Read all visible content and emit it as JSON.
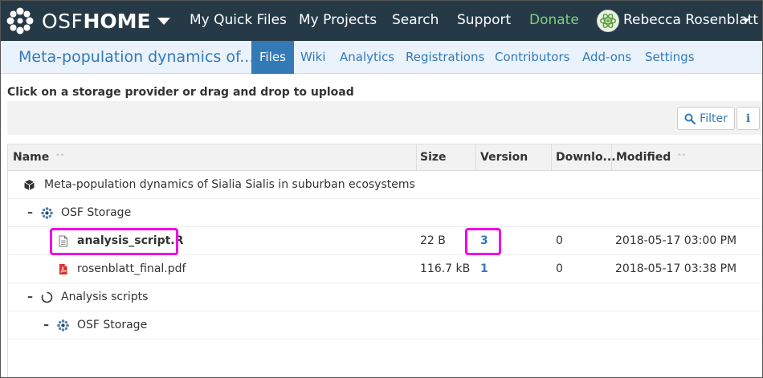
{
  "topnav": {
    "brand_osf": "OSF",
    "brand_home": "HOME",
    "links": [
      "My Quick Files",
      "My Projects",
      "Search",
      "Support"
    ],
    "donate": "Donate",
    "user_name": "Rebecca Rosenblatt",
    "colors": {
      "background": "#263947",
      "donate": "#7ed07e"
    }
  },
  "subnav": {
    "project_title": "Meta-population dynamics of...",
    "tabs": [
      "Files",
      "Wiki",
      "Analytics",
      "Registrations",
      "Contributors",
      "Add-ons",
      "Settings"
    ],
    "active_tab": "Files",
    "colors": {
      "accent": "#337ab7",
      "background": "#eaf2fb"
    }
  },
  "instruction": "Click on a storage provider or drag and drop to upload",
  "toolbar": {
    "filter_label": "Filter",
    "info_label": "i"
  },
  "grid": {
    "columns": [
      "Name",
      "Size",
      "Version",
      "Downlo...",
      "Modified"
    ],
    "rows": [
      {
        "name": "Meta-population dynamics of Sialia Sialis in suburban ecosystems",
        "icon": "cube-icon",
        "size": "",
        "version": "",
        "downloads": "",
        "modified": ""
      },
      {
        "toggle": "–",
        "name": "OSF Storage",
        "icon": "osf-storage-icon",
        "size": "",
        "version": "",
        "downloads": "",
        "modified": ""
      },
      {
        "name": "analysis_script.R",
        "icon": "file-text-icon",
        "size": "22 B",
        "version": "3",
        "downloads": "0",
        "modified": "2018-05-17 03:00 PM",
        "highlighted": true
      },
      {
        "name": "rosenblatt_final.pdf",
        "icon": "pdf-icon",
        "size": "116.7 kB",
        "version": "1",
        "downloads": "0",
        "modified": "2018-05-17 03:38 PM"
      },
      {
        "toggle": "–",
        "name": "Analysis scripts",
        "icon": "component-icon",
        "size": "",
        "version": "",
        "downloads": "",
        "modified": ""
      },
      {
        "toggle": "–",
        "name": "OSF Storage",
        "icon": "osf-storage-icon",
        "size": "",
        "version": "",
        "downloads": "",
        "modified": ""
      }
    ],
    "highlight_color": "#ee00e6"
  }
}
